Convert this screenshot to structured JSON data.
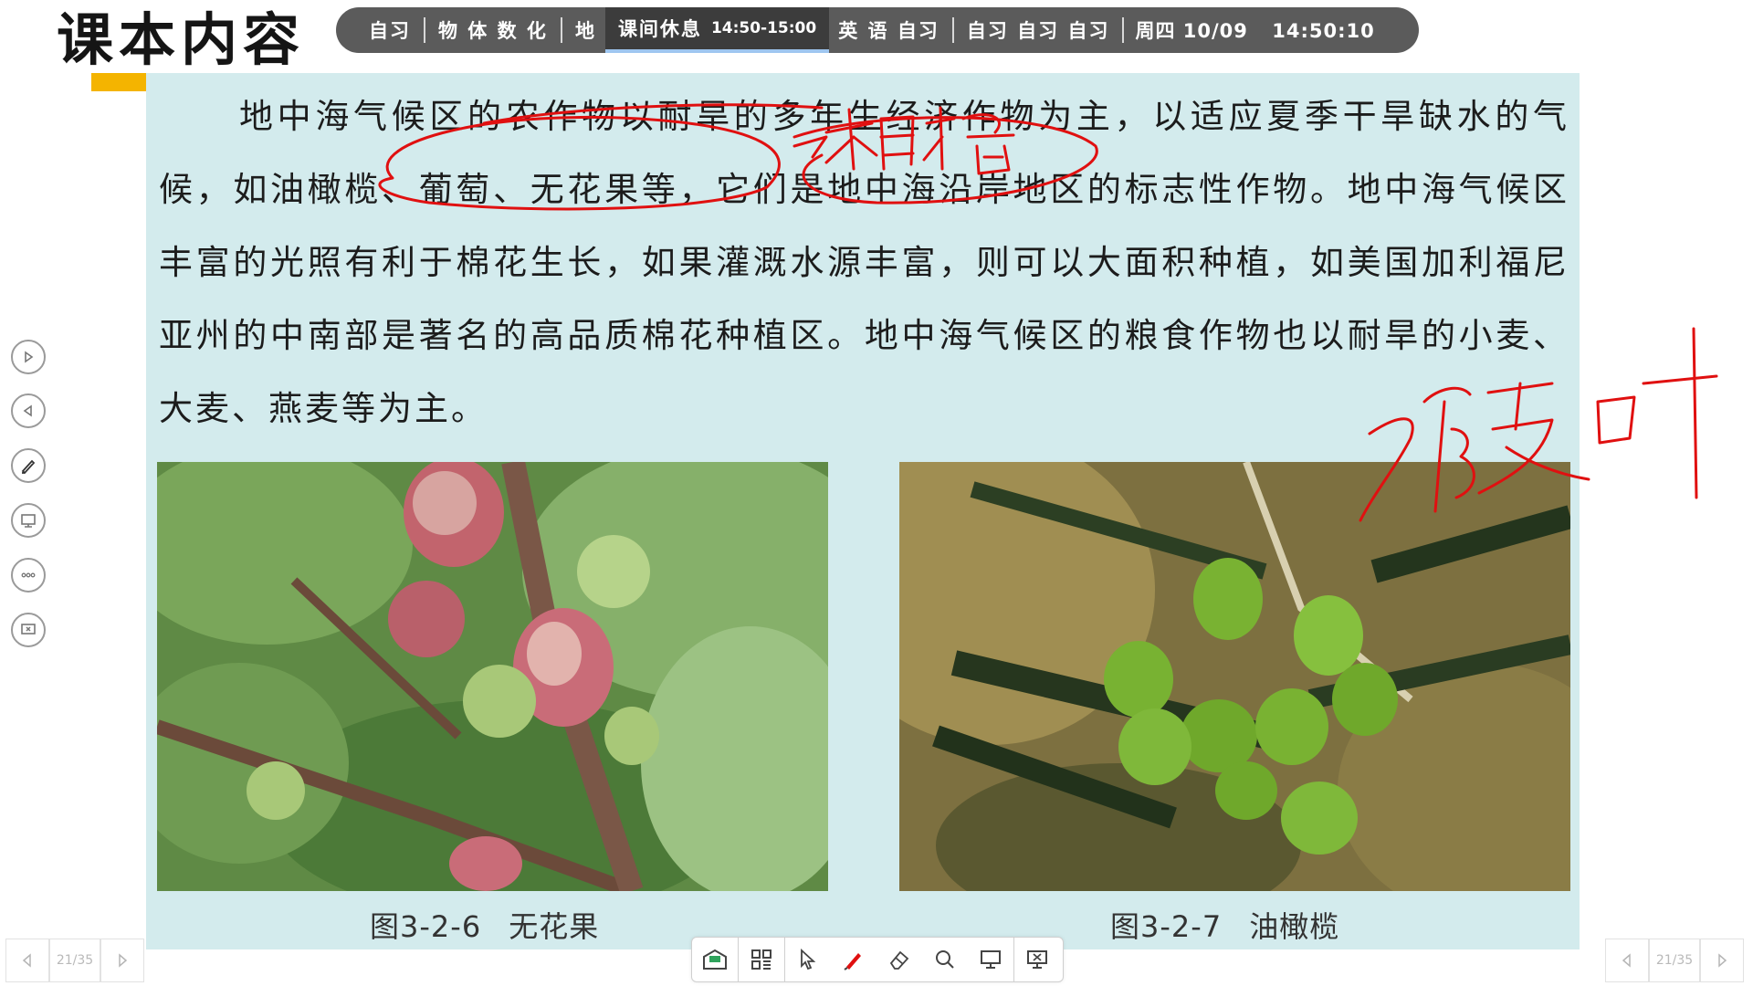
{
  "title": "课本内容",
  "schedule": {
    "items": [
      {
        "label": "自习"
      },
      {
        "label": "物 体 数 化"
      },
      {
        "label": "地"
      },
      {
        "label": "课间休息",
        "time": "14:50-15:00",
        "current": true
      },
      {
        "label": "英 语 自习"
      },
      {
        "label": "自习 自习 自习"
      }
    ],
    "day_date": "周四 10/09",
    "clock": "14:50:10"
  },
  "content": {
    "paragraph": "地中海气候区的农作物以耐旱的多年生经济作物为主，以适应夏季干旱缺水的气候，如油橄榄、葡萄、无花果等，它们是地中海沿岸地区的标志性作物。地中海气候区丰富的光照有利于棉花生长，如果灌溉水源丰富，则可以大面积种植，如美国加利福尼亚州的中南部是著名的高品质棉花种植区。地中海气候区的粮食作物也以耐旱的小麦、大麦、燕麦等为主。",
    "figures": [
      {
        "number": "图3-2-6",
        "caption": "无花果"
      },
      {
        "number": "图3-2-7",
        "caption": "油橄榄"
      }
    ]
  },
  "annotations": [
    {
      "type": "handwriting",
      "text": "柑橘"
    },
    {
      "type": "handwriting",
      "text": "硬叶"
    }
  ],
  "colors": {
    "panel": "#d3ebed",
    "accent": "#f4b400",
    "ink": "#e01010",
    "schedule_bg": "#5b5b5b"
  },
  "left_toolbar": [
    "play-icon",
    "back-icon",
    "pen-icon",
    "screen-icon",
    "more-icon",
    "exit-icon"
  ],
  "bottom_toolbar": [
    "whiteboard-icon",
    "apps-icon",
    "pointer-icon",
    "pen-icon",
    "eraser-icon",
    "zoom-icon",
    "screen-icon",
    "close-screen-icon"
  ],
  "pager": {
    "current": 21,
    "total": 35,
    "label": "21/35"
  }
}
